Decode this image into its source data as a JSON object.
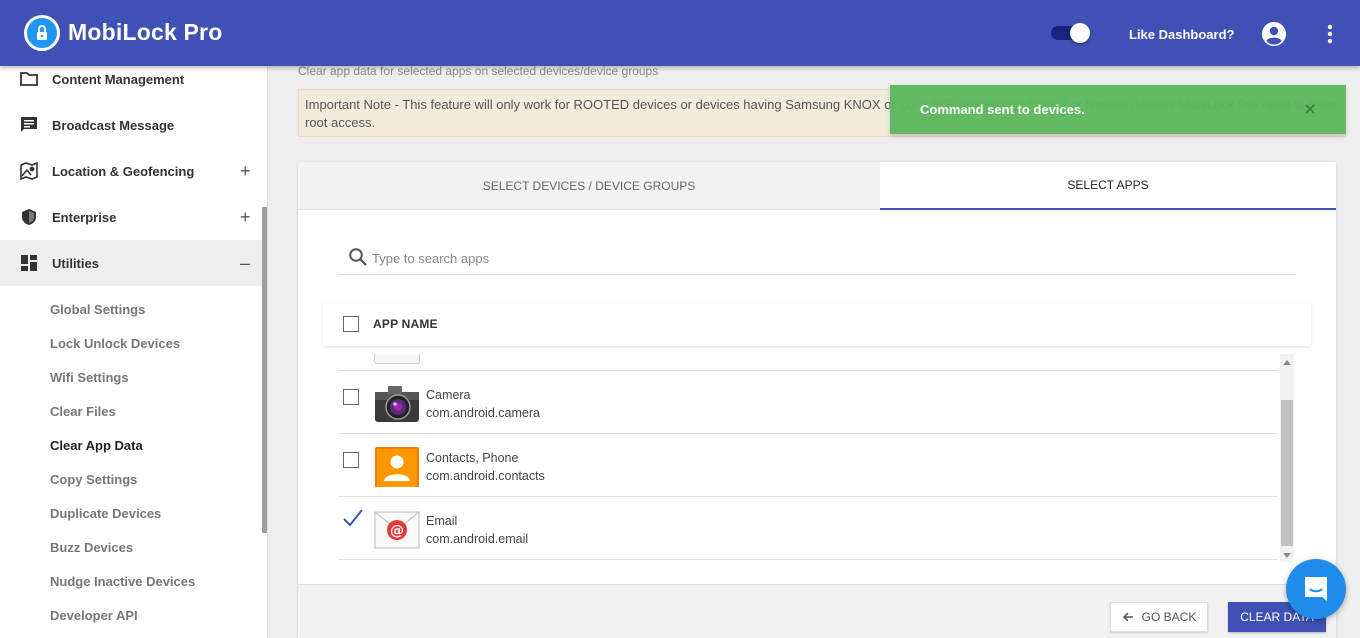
{
  "header": {
    "brand": "MobiLock Pro",
    "like_dashboard": "Like Dashboard?",
    "toggle_on": true,
    "accent_color": "#3f51b5"
  },
  "sidebar": {
    "items": [
      {
        "label": "Content Management",
        "icon": "folder-icon"
      },
      {
        "label": "Broadcast Message",
        "icon": "message-icon"
      },
      {
        "label": "Location & Geofencing",
        "icon": "map-icon",
        "expand": "+"
      },
      {
        "label": "Enterprise",
        "icon": "shield-icon",
        "expand": "+"
      },
      {
        "label": "Utilities",
        "icon": "dashboard-icon",
        "expand": "–"
      }
    ],
    "sub_items": [
      "Global Settings",
      "Lock Unlock Devices",
      "Wifi Settings",
      "Clear Files",
      "Clear App Data",
      "Copy Settings",
      "Duplicate Devices",
      "Buzz Devices",
      "Nudge Inactive Devices",
      "Developer API"
    ],
    "current_sub_item": "Clear App Data"
  },
  "main": {
    "subtitle": "Clear app data for selected apps on selected devices/device groups",
    "note": "Important Note - This feature will only work for ROOTED devices or devices having Samsung KNOX or LG GATE enabled on them. For Rooted devices MobiLock Pro need to have root access.",
    "tabs": [
      {
        "label": "SELECT DEVICES / DEVICE GROUPS",
        "active": false
      },
      {
        "label": "SELECT APPS",
        "active": true
      }
    ],
    "search": {
      "placeholder": "Type to search apps",
      "value": ""
    },
    "table": {
      "header": "APP NAME",
      "rows": [
        {
          "name": "Camera",
          "package": "com.android.camera",
          "checked": false,
          "icon": "camera-icon"
        },
        {
          "name": "Contacts, Phone",
          "package": "com.android.contacts",
          "checked": false,
          "icon": "contacts-icon"
        },
        {
          "name": "Email",
          "package": "com.android.email",
          "checked": true,
          "icon": "email-icon"
        }
      ]
    },
    "buttons": {
      "go_back": "GO BACK",
      "clear_data": "CLEAR DATA"
    }
  },
  "toast": {
    "message": "Command sent to devices.",
    "color": "#5cb85c"
  }
}
